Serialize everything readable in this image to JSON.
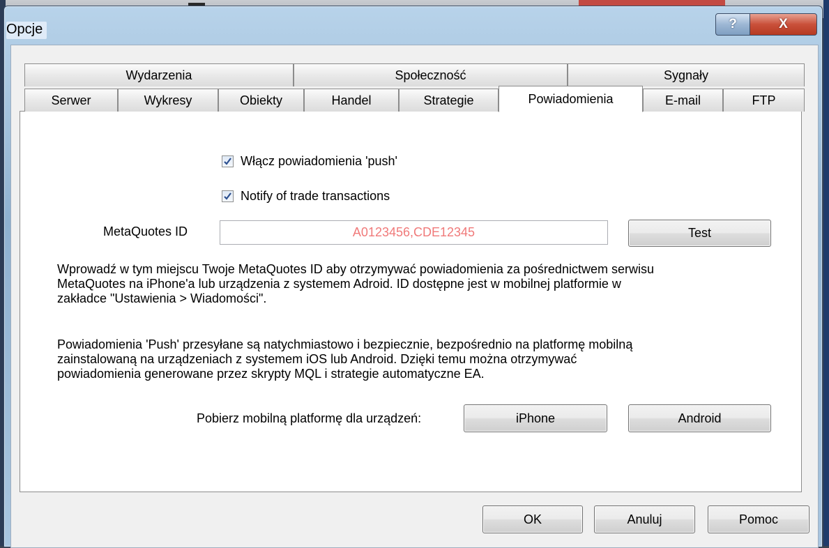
{
  "window": {
    "title": "Opcje",
    "help_label": "?",
    "close_label": "X"
  },
  "tabs_row1": [
    {
      "label": "Wydarzenia"
    },
    {
      "label": "Społeczność"
    },
    {
      "label": "Sygnały"
    }
  ],
  "tabs_row2": [
    {
      "label": "Serwer"
    },
    {
      "label": "Wykresy"
    },
    {
      "label": "Obiekty"
    },
    {
      "label": "Handel"
    },
    {
      "label": "Strategie"
    },
    {
      "label": "Powiadomienia",
      "active": true
    },
    {
      "label": "E-mail"
    },
    {
      "label": "FTP"
    }
  ],
  "notifications": {
    "enable_push_label": "Włącz powiadomienia 'push'",
    "enable_push_checked": true,
    "notify_trade_label": "Notify of trade transactions",
    "notify_trade_checked": true,
    "metaquotes_id_label": "MetaQuotes ID",
    "metaquotes_id_value": "A0123456,CDE12345",
    "test_label": "Test",
    "info_line1": "Wprowadź w tym miejscu Twoje MetaQuotes ID aby otrzymywać powiadomienia za pośrednictwem serwisu",
    "info_line2": "MetaQuotes na iPhone'a lub urządzenia z systemem Adroid. ID dostępne jest w mobilnej platformie w",
    "info_line3": "zakładce \"Ustawienia > Wiadomości\".",
    "push_line1": "Powiadomienia 'Push' przesyłane są natychmiastowo i bezpiecznie, bezpośrednio na platformę mobilną",
    "push_line2": "zainstalowaną na urządzeniach z systemem iOS lub Android. Dzięki temu można otrzymywać",
    "push_line3": "powiadomienia generowane przez skrypty MQL i strategie automatyczne EA.",
    "download_label": "Pobierz mobilną platformę dla urządzeń:",
    "iphone_label": "iPhone",
    "android_label": "Android"
  },
  "footer": {
    "ok_label": "OK",
    "cancel_label": "Anuluj",
    "help_label": "Pomoc"
  },
  "colors": {
    "id_text": "#f07a7a",
    "checkbox_tick": "#2b4f8f"
  }
}
